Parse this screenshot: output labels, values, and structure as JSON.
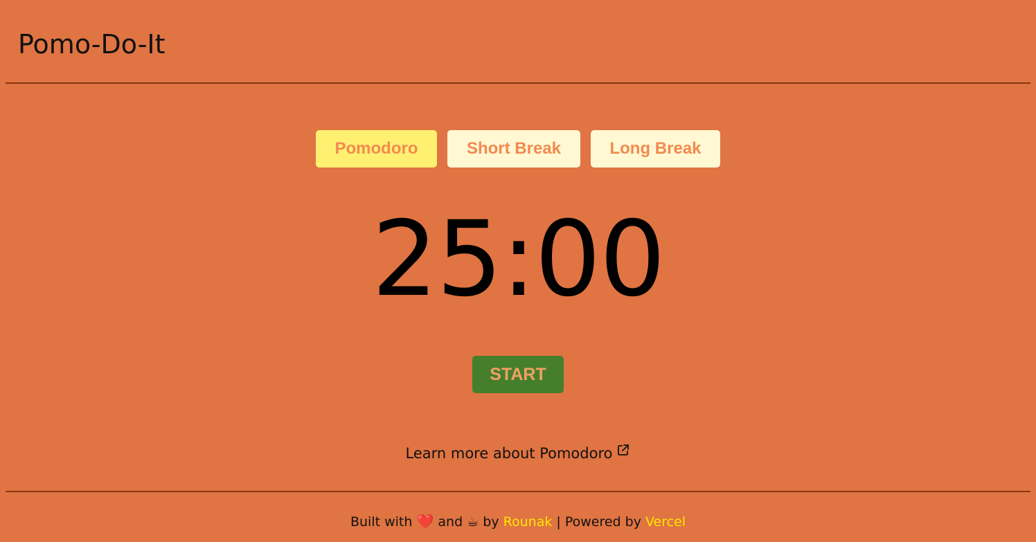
{
  "header": {
    "title": "Pomo-Do-It"
  },
  "modes": {
    "pomodoro": "Pomodoro",
    "short_break": "Short Break",
    "long_break": "Long Break",
    "active": "Pomodoro"
  },
  "timer": {
    "display": "25:00"
  },
  "controls": {
    "start_label": "START"
  },
  "learn": {
    "text": "Learn more about Pomodoro",
    "icon": "external-link-icon"
  },
  "footer": {
    "built_with": "Built with",
    "heart": "❤️",
    "and": "and",
    "coffee": "☕",
    "by": "by",
    "author": "Rounak",
    "separator": "|",
    "powered_by": "Powered by",
    "host": "Vercel"
  },
  "colors": {
    "background": "#e07443",
    "active_tab": "#fff072",
    "inactive_tab": "#fff8d2",
    "tab_text": "#f28a50",
    "start_button": "#467f2c",
    "start_text": "#f2a066",
    "link": "#ffe500",
    "divider": "#8a3510"
  }
}
